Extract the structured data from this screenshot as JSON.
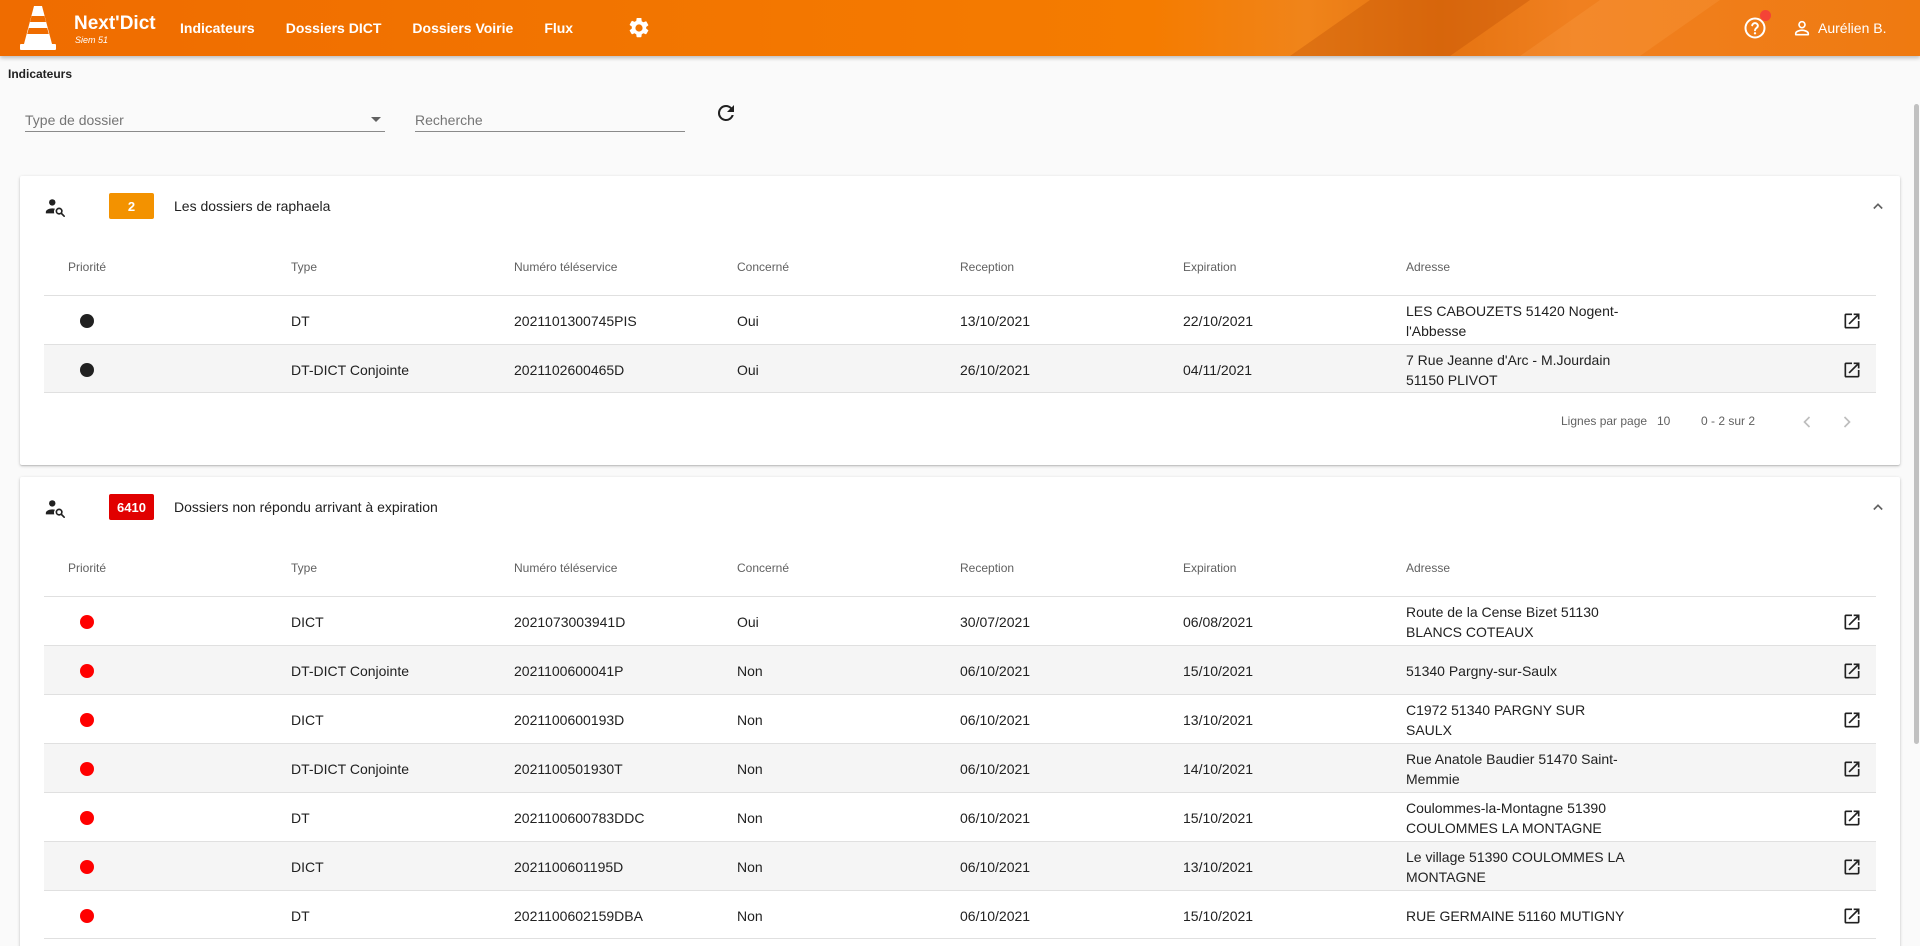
{
  "app": {
    "name": "Next'Dict",
    "subtitle": "Siem 51",
    "nav": [
      "Indicateurs",
      "Dossiers DICT",
      "Dossiers Voirie",
      "Flux"
    ],
    "user": "Aurélien B.",
    "accent": "#ef6c00"
  },
  "page": {
    "title": "Indicateurs"
  },
  "filters": {
    "type_placeholder": "Type de dossier",
    "search_placeholder": "Recherche"
  },
  "columns": [
    "Priorité",
    "Type",
    "Numéro téléservice",
    "Concerné",
    "Reception",
    "Expiration",
    "Adresse"
  ],
  "cards": [
    {
      "count": "2",
      "badge_color": "#f39200",
      "title": "Les dossiers de raphaela",
      "rows": [
        {
          "priority_color": "#212121",
          "type": "DT",
          "numero": "2021101300745PIS",
          "concerne": "Oui",
          "reception": "13/10/2021",
          "expiration": "22/10/2021",
          "adresse": "LES CABOUZETS 51420 Nogent-l'Abbesse"
        },
        {
          "priority_color": "#212121",
          "type": "DT-DICT Conjointe",
          "numero": "2021102600465D",
          "concerne": "Oui",
          "reception": "26/10/2021",
          "expiration": "04/11/2021",
          "adresse": "7 Rue Jeanne d'Arc - M.Jourdain 51150 PLIVOT"
        }
      ],
      "pager": {
        "rows_label": "Lignes par page",
        "rows_value": "10",
        "range": "0 - 2 sur 2"
      }
    },
    {
      "count": "6410",
      "badge_color": "#e10000",
      "title": "Dossiers non répondu arrivant à expiration",
      "rows": [
        {
          "priority_color": "#ff0000",
          "type": "DICT",
          "numero": "2021073003941D",
          "concerne": "Oui",
          "reception": "30/07/2021",
          "expiration": "06/08/2021",
          "adresse": "Route de la Cense Bizet 51130 BLANCS COTEAUX"
        },
        {
          "priority_color": "#ff0000",
          "type": "DT-DICT Conjointe",
          "numero": "2021100600041P",
          "concerne": "Non",
          "reception": "06/10/2021",
          "expiration": "15/10/2021",
          "adresse": "51340 Pargny-sur-Saulx"
        },
        {
          "priority_color": "#ff0000",
          "type": "DICT",
          "numero": "2021100600193D",
          "concerne": "Non",
          "reception": "06/10/2021",
          "expiration": "13/10/2021",
          "adresse": "C1972 51340 PARGNY SUR SAULX"
        },
        {
          "priority_color": "#ff0000",
          "type": "DT-DICT Conjointe",
          "numero": "2021100501930T",
          "concerne": "Non",
          "reception": "06/10/2021",
          "expiration": "14/10/2021",
          "adresse": "Rue Anatole Baudier 51470 Saint-Memmie"
        },
        {
          "priority_color": "#ff0000",
          "type": "DT",
          "numero": "2021100600783DDC",
          "concerne": "Non",
          "reception": "06/10/2021",
          "expiration": "15/10/2021",
          "adresse": "Coulommes-la-Montagne 51390 COULOMMES LA MONTAGNE"
        },
        {
          "priority_color": "#ff0000",
          "type": "DICT",
          "numero": "2021100601195D",
          "concerne": "Non",
          "reception": "06/10/2021",
          "expiration": "13/10/2021",
          "adresse": "Le village 51390 COULOMMES LA MONTAGNE"
        },
        {
          "priority_color": "#ff0000",
          "type": "DT",
          "numero": "2021100602159DBA",
          "concerne": "Non",
          "reception": "06/10/2021",
          "expiration": "15/10/2021",
          "adresse": "RUE GERMAINE 51160 MUTIGNY"
        }
      ]
    }
  ]
}
